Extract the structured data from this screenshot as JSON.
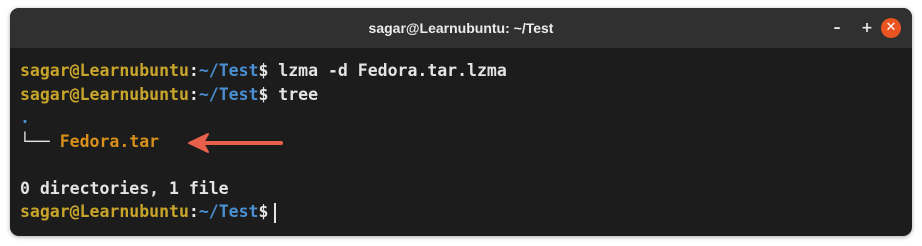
{
  "window": {
    "title": "sagar@Learnubuntu: ~/Test",
    "minimize_glyph": "–",
    "maximize_glyph": "+",
    "close_glyph": "✕"
  },
  "terminal": {
    "prompt_user": "sagar@Learnubuntu",
    "prompt_colon": ":",
    "prompt_path": "~/Test",
    "prompt_symbol": "$",
    "lines": {
      "cmd1": " lzma -d Fedora.tar.lzma",
      "cmd2": " tree",
      "tree_root": ".",
      "tree_branch": "└── ",
      "tree_file": "Fedora.tar",
      "summary": "0 directories, 1 file",
      "cmd3": " "
    }
  },
  "colors": {
    "user": "#c8a52a",
    "path": "#4a8fd2",
    "file": "#d7901a",
    "arrow": "#e8604c",
    "close_button": "#e95420"
  },
  "annotation": {
    "icon": "red-arrow-icon"
  }
}
